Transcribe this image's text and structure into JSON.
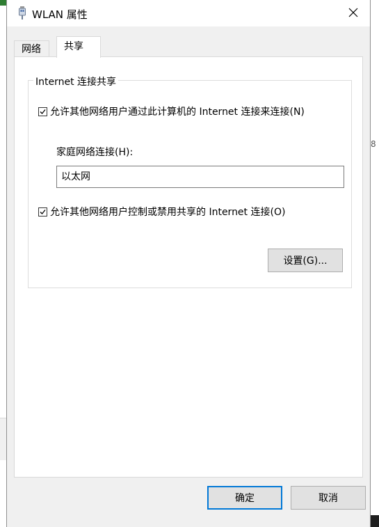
{
  "window": {
    "title": "WLAN 属性",
    "close_icon": "close-icon"
  },
  "tabs": [
    {
      "label": "网络",
      "active": false
    },
    {
      "label": "共享",
      "active": true
    }
  ],
  "sharing": {
    "group_title": "Internet 连接共享",
    "allow_connect": {
      "label": "允许其他网络用户通过此计算机的 Internet 连接来连接(N)",
      "checked": true
    },
    "home_network": {
      "label": "家庭网络连接(H):",
      "value": "以太网"
    },
    "allow_control": {
      "label": "允许其他网络用户控制或禁用共享的 Internet 连接(O)",
      "checked": true
    },
    "settings_button": "设置(G)..."
  },
  "footer": {
    "ok_button": "确定",
    "cancel_button": "取消"
  },
  "background": {
    "right_edge_text": "8"
  }
}
